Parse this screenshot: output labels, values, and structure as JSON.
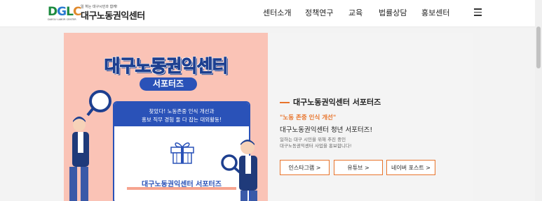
{
  "header": {
    "logo": {
      "mark": "DGLC",
      "english": "DAEGU LABOR CENTER",
      "tagline": "일 하는 대구시민과 함께!",
      "name": "대구노동권익센터"
    },
    "nav": [
      "센터소개",
      "정책연구",
      "교육",
      "법률상담",
      "홍보센터"
    ]
  },
  "banner": {
    "title": "대구노동권익센터",
    "pill": "서포터즈",
    "box_line1": "찾았다! 노동존중 인식 개선과",
    "box_line2": "홍보 직무 경험 둘 다 잡는 대외활동!",
    "caption": "대구노동권익센터 서포터즈"
  },
  "info": {
    "heading": "대구노동권익센터 서포터즈",
    "subtitle": "\"노동 존중 인식 개선\"",
    "title": "대구노동권익센터 청년 서포터즈!",
    "desc_line1": "일하는 대구 시민을 위해 추진 중인",
    "desc_line2": "대구노동권익센터 사업을 홍보합니다!",
    "buttons": [
      "인스타그램 >",
      "유튜브 >",
      "네이버 포스트 >"
    ]
  },
  "colors": {
    "accent": "#e8742b",
    "banner_bg": "#fac3b6",
    "banner_blue": "#2a52b8"
  }
}
